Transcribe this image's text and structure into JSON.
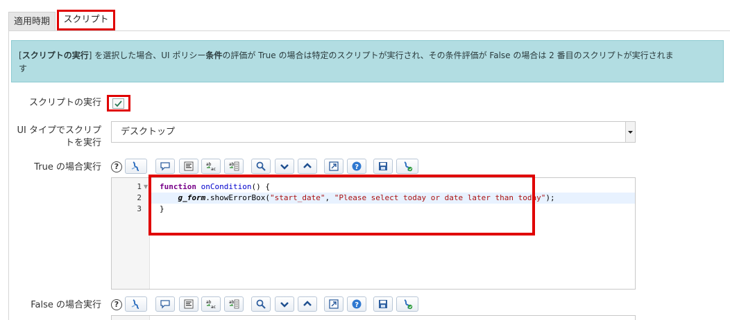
{
  "tabs": [
    {
      "label": "適用時期"
    },
    {
      "label": "スクリプト"
    }
  ],
  "info": {
    "open_bracket": "[",
    "bold_1": "スクリプトの実行",
    "text_1": "] を選択した場合、UI ポリシー",
    "bold_2": "条件",
    "text_2": "の評価が True の場合は特定のスクリプトが実行され、その条件評価が False の場合は 2 番目のスクリプトが実行されま",
    "text_3": "す"
  },
  "form": {
    "run_scripts_label": "スクリプトの実行",
    "run_scripts_checked": true,
    "ui_type_label_line1": "UI タイプでスクリプ",
    "ui_type_label_line2": "トを実行",
    "ui_type_value": "デスクトップ",
    "true_script_label": "True の場合実行",
    "false_script_label": "False の場合実行",
    "help_glyph": "?"
  },
  "toolbar_icons": [
    "toggle-syntax-icon",
    "comment-icon",
    "format-icon",
    "replace-icon",
    "replace-all-icon",
    "search-icon",
    "chevron-down-icon",
    "chevron-up-icon",
    "fullscreen-icon",
    "help-icon",
    "save-icon",
    "script-debug-icon"
  ],
  "editor": {
    "line_numbers": [
      "1",
      "2",
      "3"
    ],
    "line1_keyword": "function",
    "line1_name": "onCondition",
    "line1_rest": "() {",
    "line2_var": "g_form",
    "line2_method": ".showErrorBox(",
    "line2_arg1": "\"start_date\"",
    "line2_sep": ", ",
    "line2_arg2": "\"Please select today or date later than today\"",
    "line2_end": ");",
    "line3": "}"
  },
  "colors": {
    "highlight_red": "#e00000",
    "info_bg": "#b2dde2",
    "keyword": "#770088",
    "function_name": "#0000cc",
    "string": "#aa1111"
  }
}
